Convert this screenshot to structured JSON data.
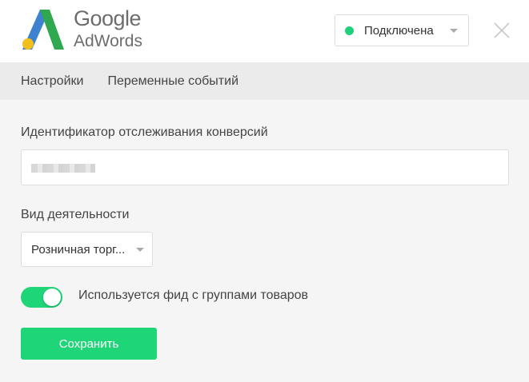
{
  "colors": {
    "accent": "#5b6bc0",
    "status_green": "#1fd07a",
    "button_green": "#1ed578",
    "logo_blue": "#3e82d0",
    "logo_green": "#2fa84f",
    "logo_yellow": "#f3bf1a"
  },
  "header": {
    "logo_line1": "Google",
    "logo_line2": "AdWords",
    "status": {
      "label": "Подключена",
      "icon": "status-dot-icon"
    },
    "close_icon": "close-icon"
  },
  "tabs": [
    {
      "label": "Настройки"
    },
    {
      "label": "Переменные событий"
    }
  ],
  "form": {
    "conversion_id_label": "Идентификатор отслеживания конверсий",
    "activity_label": "Вид деятельности",
    "activity_value": "Розничная торг...",
    "feed_toggle": {
      "label": "Используется фид с группами товаров",
      "on": true
    },
    "save_label": "Сохранить"
  }
}
